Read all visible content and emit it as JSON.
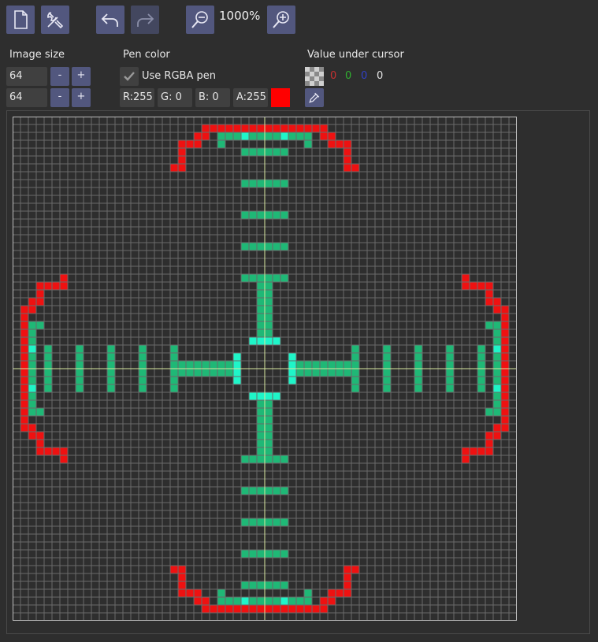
{
  "toolbar": {
    "buttons": [
      {
        "name": "new-file-button",
        "icon": "new-file-icon",
        "enabled": true
      },
      {
        "name": "tools-button",
        "icon": "tools-icon",
        "enabled": true
      },
      {
        "name": "undo-button",
        "icon": "undo-icon",
        "enabled": true
      },
      {
        "name": "redo-button",
        "icon": "redo-icon",
        "enabled": false
      },
      {
        "name": "zoom-out-button",
        "icon": "zoom-out-icon",
        "enabled": true
      },
      {
        "name": "zoom-in-button",
        "icon": "zoom-in-icon",
        "enabled": true
      }
    ],
    "zoom": "1000%"
  },
  "image_size": {
    "label": "Image size",
    "width": "64",
    "height": "64",
    "minus": "-",
    "plus": "+"
  },
  "pen_color": {
    "label": "Pen color",
    "use_rgba_label": "Use RGBA pen",
    "use_rgba_checked": true,
    "r": "R:255",
    "g": "G:  0",
    "b": "B:  0",
    "a": "A:255",
    "swatch_color": "#ff0000"
  },
  "value_under_cursor": {
    "label": "Value under cursor",
    "r": "0",
    "g": "0",
    "b": "0",
    "a": "0",
    "r_color": "#c83030",
    "g_color": "#30b030",
    "b_color": "#3040c8",
    "a_color": "#e6e6e6"
  },
  "canvas": {
    "pixel_size": 64,
    "grid_color": "#6a6a6a",
    "axis_color": "#d8e8a0",
    "colors": {
      "red": "#ee1111",
      "green": "#1fb876",
      "cyan": "#1ff5c8"
    }
  }
}
